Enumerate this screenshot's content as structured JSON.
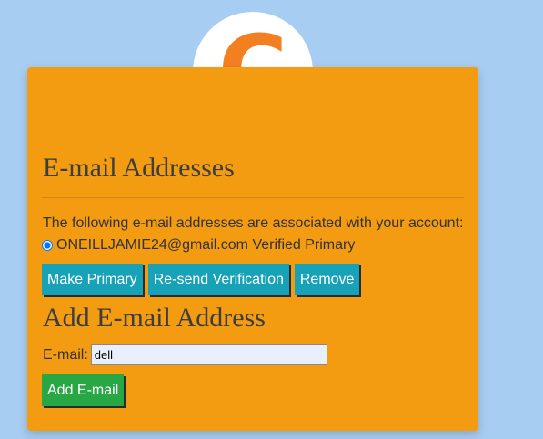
{
  "logo": {
    "letter": "C"
  },
  "page": {
    "title": "E-mail Addresses",
    "intro": "The following e-mail addresses are associated with your account:"
  },
  "emails": [
    {
      "address": "ONEILLJAMIE24@gmail.com",
      "status": "Verified Primary",
      "selected": true
    }
  ],
  "actions": {
    "make_primary": "Make Primary",
    "resend": "Re-send Verification",
    "remove": "Remove"
  },
  "add_section": {
    "title": "Add E-mail Address",
    "field_label": "E-mail:",
    "field_value": "dell",
    "submit_label": "Add E-mail"
  },
  "colors": {
    "background": "#a7cdf2",
    "card": "#f39c12",
    "logo": "#f47f21",
    "teal_button": "#17a2b8",
    "green_button": "#28a745"
  }
}
